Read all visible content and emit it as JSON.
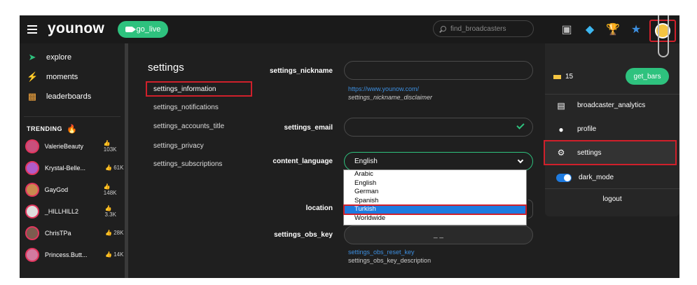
{
  "header": {
    "logo": "younow",
    "go_live_label": "go_live",
    "search_placeholder": "find_broadcasters",
    "icons": [
      "chat-icon",
      "diamond-icon",
      "trophy-icon",
      "star-icon",
      "avatar"
    ]
  },
  "sidebar": {
    "nav": [
      {
        "label": "explore",
        "icon": "rocket-icon"
      },
      {
        "label": "moments",
        "icon": "bolt-icon"
      },
      {
        "label": "leaderboards",
        "icon": "podium-icon"
      }
    ],
    "trending_label": "TRENDING",
    "trending": [
      {
        "name": "ValerieBeauty",
        "count": "103K",
        "color": "#c94f7c"
      },
      {
        "name": "Krystal-Belle...",
        "count": "61K",
        "color": "#b05cc9"
      },
      {
        "name": "GayGod",
        "count": "148K",
        "color": "#c98a4f"
      },
      {
        "name": "_HILLHILL2",
        "count": "3.3K",
        "color": "#dddddd"
      },
      {
        "name": "ChrisTPa",
        "count": "28K",
        "color": "#7c5c4f"
      },
      {
        "name": "Princess.Butt...",
        "count": "14K",
        "color": "#d27aa0"
      }
    ]
  },
  "settings_menu": {
    "title": "settings",
    "items": [
      "settings_information",
      "settings_notifications",
      "settings_accounts_title",
      "settings_privacy",
      "settings_subscriptions"
    ]
  },
  "form": {
    "nickname_label": "settings_nickname",
    "nickname_value": "",
    "nickname_link": "https://www.younow.com/",
    "nickname_disclaimer": "settings_nickname_disclaimer",
    "email_label": "settings_email",
    "email_value": "",
    "content_language_label": "content_language",
    "content_language_value": "English",
    "language_options": [
      "Arabic",
      "English",
      "German",
      "Spanish",
      "Turkish",
      "Worldwide"
    ],
    "language_highlighted": "Turkish",
    "location_label": "location",
    "obs_key_label": "settings_obs_key",
    "obs_key_value": "_ _",
    "obs_reset": "settings_obs_reset_key",
    "obs_description": "settings_obs_key_description"
  },
  "panel": {
    "bars_count": "15",
    "get_bars_label": "get_bars",
    "items": [
      {
        "label": "broadcaster_analytics",
        "icon": "chart-icon"
      },
      {
        "label": "profile",
        "icon": "user-icon"
      },
      {
        "label": "settings",
        "icon": "gear-icon"
      },
      {
        "label": "dark_mode",
        "icon": "toggle"
      }
    ],
    "logout_label": "logout"
  }
}
